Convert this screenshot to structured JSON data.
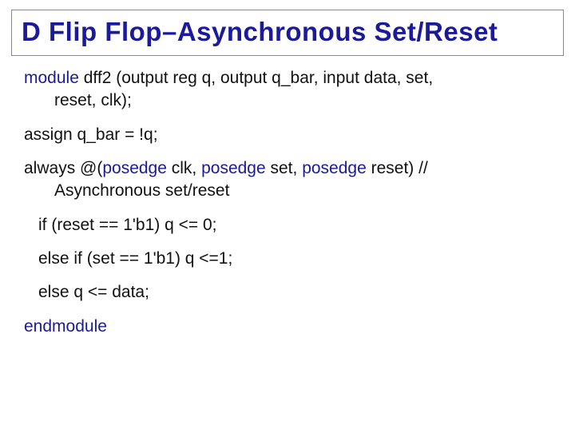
{
  "title": "D Flip Flop–Asynchronous Set/Reset",
  "code": {
    "module_kw": "module",
    "module_decl_line1": " dff2 (output reg q, output q_bar, input data, set,",
    "module_decl_line2": "reset, clk);",
    "assign_line": "assign q_bar = !q;",
    "always_line_a": "always @(",
    "posedge1": "posedge",
    "clk_txt": " clk, ",
    "posedge2": "posedge",
    "set_txt": " set, ",
    "posedge3": "posedge",
    "reset_txt": " reset)   //",
    "always_line_b": "Asynchronous set/reset",
    "if_line": "if (reset == 1'b1) q <= 0;",
    "elseif_line": "else if (set == 1'b1) q <=1;",
    "else_line": "else q <= data;",
    "endmodule_kw": "endmodule"
  }
}
